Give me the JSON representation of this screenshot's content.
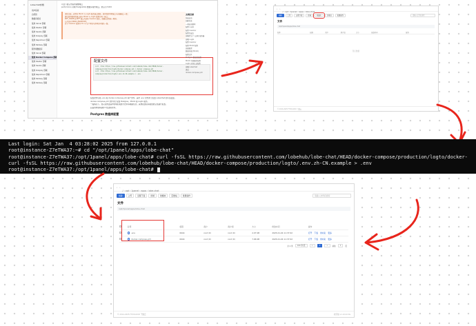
{
  "docs": {
    "app_name": "Lobechat文档",
    "sidebar_items": [
      "用户指南",
      "自托管",
      "数据库模式",
      "使用 Vercel 部署",
      "使用 Zeabur 部署",
      "使用 Sealos 部署",
      "使用 Dokploy 部署",
      "使用 RepoCloud 部署",
      "使用 Railway 部署",
      "服务端数据库",
      "使用 Vercel 部署",
      "使用 Docker Compose 部署",
      "使用 Zeabur 部署",
      "使用 Sealos 部署",
      "使用 Dokploy 部署",
      "使用 RepoCloud 部署",
      "使用 Railway 部署",
      "使用 Railway 部署"
    ],
    "active_item_index": 11,
    "intro": "以及下载它所需的镜像端口",
    "intro2": "port(minio) 对映 PostgreSQL 数据库服务端口，默认为 5432",
    "warning_lines": [
      "请您注意，对所有 MinIO 与 Logto 服务端口映射，请求保持本地端口与容器端口一致；",
      "建议使用相同的端口值为 MinIO 与 Logto 配置为同一端口；",
      "MFF_HOME 和 MFF 端口为实际 Casdoor 相关，请确认是否统一映射。",
      "公开访问 MINIO_ENDPOINT。",
      "对于 Casdoor 配置中 Do 中 生产环境与外网访问域名一致。"
    ],
    "section_title": "配置文件",
    "code_lines": [
      "curl -fsSL https://raw.githubusercontent.com/lobehub/lobe-chat/HEAD/docker-",
      "compose/production/logto/docker-compose.yml > docker-compose.yml",
      "curl -fsSL https://raw.githubusercontent.com/lobehub/lobe-chat/HEAD/docker-",
      "compose/production/logto/.env.zh-CN.example > .env"
    ],
    "after_lines": [
      "配置文件包括 .env 和 docker-compose.yml 两个文件，其中 .env 文件用于配置 LobeChat 的环境变量，",
      "docker-compose.yml 文件用于配置 Postgres、MinIO 和 Logto 服务。",
      "一般情况下，您只应修改其中的域名和账号密码等敏感信息，其他配置项请按照默认值进行配置。",
      "后面的内容将逐步介绍这些文件。"
    ],
    "subheading": "Postgres 数据库配置",
    "toc_title": "文档目录",
    "toc_items": [
      "快速启动",
      "创建目录",
      "一键启动脚本",
      "配置 Logto",
      "配置 Casdoor",
      "配置完成后",
      "部署至生产 (公网) 服务器",
      "部署 Logto",
      "配置 Casdoor",
      "配置 MinIO 配置",
      "高级配置",
      "数据存储 (MinIO)",
      "配置文件",
      "Postgres 数据库配置",
      "MinIO 存储服务配置",
      "Logto 身份认证配置",
      "部署 LobeChat",
      "退出",
      "docker-compose.yml"
    ],
    "footer": "© 2025 LobeHub"
  },
  "empty_folder": {
    "breadcrumb": [
      "/",
      "opt",
      "1panel",
      "apps",
      "lobe-chat"
    ],
    "toolbar": [
      "创建",
      "上传",
      "远程下载",
      "终端",
      "收藏夹",
      "回收站",
      "批量操作"
    ],
    "flagged_button_index": 4,
    "search_placeholder": "请输入文件名搜索",
    "title": "文件",
    "path": "/opt/1panel/apps/lobe-chat",
    "columns": [
      "名称",
      "权限",
      "用户",
      "用户组",
      "大小",
      "修改时间",
      "操作"
    ],
    "empty_text": "暂无数据",
    "footer": "© 2014-2025 FIT2CLOUD 飞致云"
  },
  "terminal": {
    "lines": [
      "Last login: Sat Jan  4 03:28:02 2025 from 127.0.0.1",
      "root@instance-Z7eTWA37:~# cd \"/opt/1panel/apps/lobe-chat\"",
      "root@instance-Z7eTWA37:/opt/1panel/apps/lobe-chat# curl -fsSL https://raw.githubusercontent.com/lobehub/lobe-chat/HEAD/docker-compose/production/logto/docker-compose.yml > docker-compose.yml",
      "curl -fsSL https://raw.githubusercontent.com/lobehub/lobe-chat/HEAD/docker-compose/production/logto/.env.zh-CN.example > .env",
      "root@instance-Z7eTWA37:/opt/1panel/apps/lobe-chat# "
    ]
  },
  "files": {
    "breadcrumb": [
      "/",
      "opt",
      "1panel",
      "apps",
      "lobe-chat"
    ],
    "toolbar": [
      "创建",
      "上传",
      "远程下载",
      "终端",
      "收藏夹",
      "回收站",
      "批量操作"
    ],
    "search_placeholder": "请输入文件名搜索",
    "title": "文件",
    "path": "/opt/1panel/apps/lobe-chat",
    "columns": [
      "名称",
      "权限",
      "用户",
      "用户组",
      "大小",
      "修改时间",
      "操作"
    ],
    "rows": [
      {
        "name": ".env",
        "perm": "0644",
        "user": "root (0)",
        "group": "root (0)",
        "size": "2.07 KB",
        "mtime": "2025-01-04 11:37:02",
        "actions": [
          "打开",
          "下载",
          "重命名",
          "更多"
        ]
      },
      {
        "name": "docker-compose.yml",
        "perm": "0644",
        "user": "root (0)",
        "group": "root (0)",
        "size": "7.96 KB",
        "mtime": "2025-01-04 11:37:02",
        "actions": [
          "打开",
          "下载",
          "重命名",
          "更多"
        ]
      }
    ],
    "pager": {
      "total": "共 2 条",
      "size": "100 条/页",
      "prev": "<",
      "page": "1",
      "next": ">",
      "goto": "前往",
      "goto_page": "1",
      "page_word": "页"
    },
    "footer_left": "© 2014-2025 FIT2CLOUD 飞致云",
    "footer_right": "社区版 v1.10.22-lts"
  },
  "accent": "#2f6bd3",
  "highlight_color": "#e53935"
}
